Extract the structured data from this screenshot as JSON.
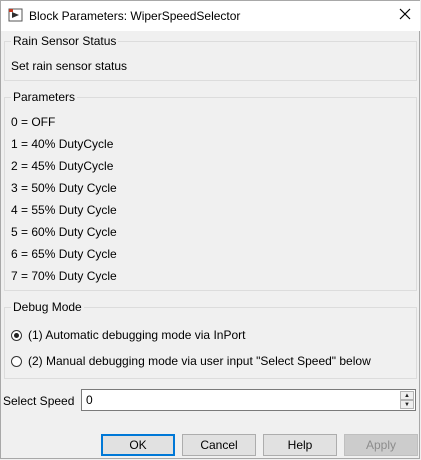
{
  "window": {
    "title": "Block Parameters: WiperSpeedSelector",
    "icon": "simulink-block-icon",
    "close_icon": "close-icon"
  },
  "rain_sensor_group": {
    "legend": "Rain Sensor Status",
    "description": "Set rain sensor status"
  },
  "parameters_group": {
    "legend": "Parameters",
    "lines": [
      "0 = OFF",
      "1 = 40% DutyCycle",
      "2 = 45% DutyCycle",
      "3 = 50% Duty Cycle",
      "4 = 55% Duty Cycle",
      "5 = 60% Duty Cycle",
      "6 = 65% Duty Cycle",
      "7 = 70% Duty Cycle"
    ]
  },
  "debug_group": {
    "legend": "Debug Mode",
    "options": [
      {
        "label": "(1) Automatic debugging mode via InPort",
        "selected": true
      },
      {
        "label": "(2) Manual debugging mode via user input \"Select Speed\" below",
        "selected": false
      }
    ]
  },
  "select_speed": {
    "label": "Select Speed",
    "value": "0"
  },
  "buttons": {
    "ok": "OK",
    "cancel": "Cancel",
    "help": "Help",
    "apply": "Apply"
  }
}
